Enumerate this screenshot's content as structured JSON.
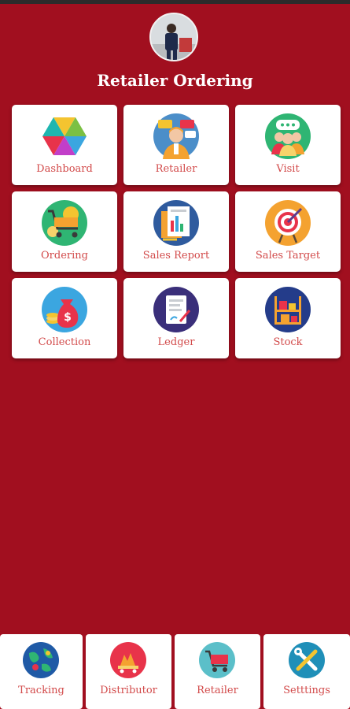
{
  "app": {
    "title": "Retailer Ordering"
  },
  "profile": {
    "avatar_icon": "user-photo-icon"
  },
  "menu": [
    {
      "label": "Dashboard",
      "icon": "dashboard-icon"
    },
    {
      "label": "Retailer",
      "icon": "retailer-icon"
    },
    {
      "label": "Visit",
      "icon": "visit-icon"
    },
    {
      "label": "Ordering",
      "icon": "ordering-icon"
    },
    {
      "label": "Sales Report",
      "icon": "sales-report-icon"
    },
    {
      "label": "Sales Target",
      "icon": "sales-target-icon"
    },
    {
      "label": "Collection",
      "icon": "collection-icon"
    },
    {
      "label": "Ledger",
      "icon": "ledger-icon"
    },
    {
      "label": "Stock",
      "icon": "stock-icon"
    }
  ],
  "bottom_nav": [
    {
      "label": "Tracking",
      "icon": "tracking-icon"
    },
    {
      "label": "Distributor",
      "icon": "distributor-icon"
    },
    {
      "label": "Retailer",
      "icon": "cart-icon"
    },
    {
      "label": "Setttings",
      "icon": "settings-icon"
    }
  ],
  "colors": {
    "background": "#a10f1f",
    "tile": "#ffffff",
    "label": "#d24a4a",
    "title": "#ffffff"
  }
}
